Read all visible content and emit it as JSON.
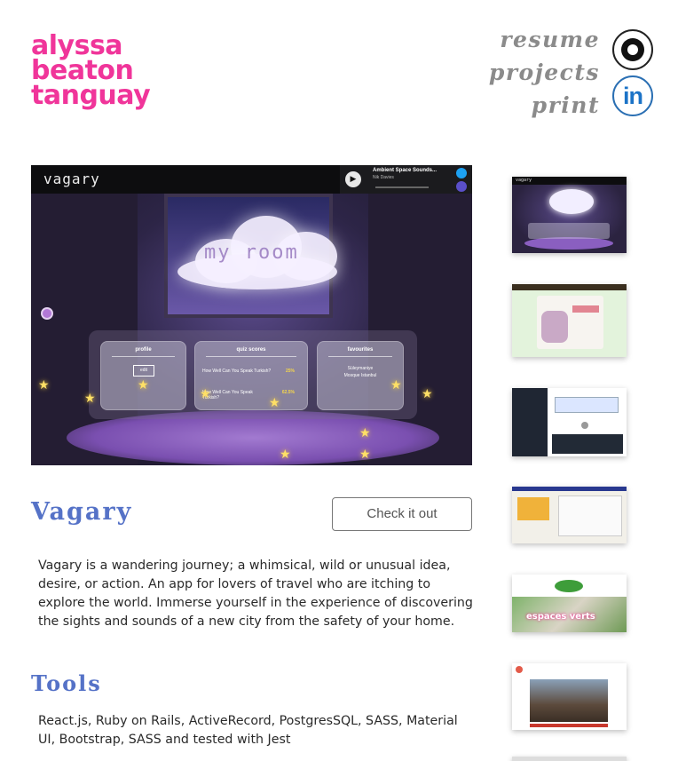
{
  "brand": {
    "line1": "alyssa",
    "line2": "beaton",
    "line3": "tanguay",
    "color": "#f0359a"
  },
  "nav": {
    "items": [
      "resume",
      "projects",
      "print"
    ]
  },
  "social": {
    "github_icon": "github-icon",
    "linkedin_label": "in"
  },
  "screenshot": {
    "app_name": "vagary",
    "player": {
      "title": "Ambient Space Sounds...",
      "artist": "Nik Davies"
    },
    "room_label": "my room",
    "cards": [
      {
        "title": "profile",
        "button": "edit"
      },
      {
        "title": "quiz scores",
        "rows": [
          {
            "label": "How Well Can You Speak Turkish?",
            "score": "25%"
          },
          {
            "label": "How Well Can You Speak Turkish?",
            "score": "62.5%"
          }
        ]
      },
      {
        "title": "favourites",
        "items": [
          "Süleymaniye",
          "Mosque Istanbul"
        ]
      }
    ]
  },
  "project": {
    "title": "Vagary",
    "cta": "Check it out",
    "description": "Vagary is a wandering journey; a whimsical, wild or unusual idea, desire, or action. An app for lovers of travel who are itching to explore the world. Immerse yourself in the experience of discovering the sights and sounds of a new city from the safety of your home.",
    "tools_heading": "Tools",
    "tools": "React.js, Ruby on Rails, ActiveRecord, PostgresSQL, SASS, Material UI, Bootstrap, SASS and tested with Jest",
    "accent": "#5572c7"
  },
  "thumbnails": {
    "t1": "vagary",
    "t5": "espaces verts"
  }
}
